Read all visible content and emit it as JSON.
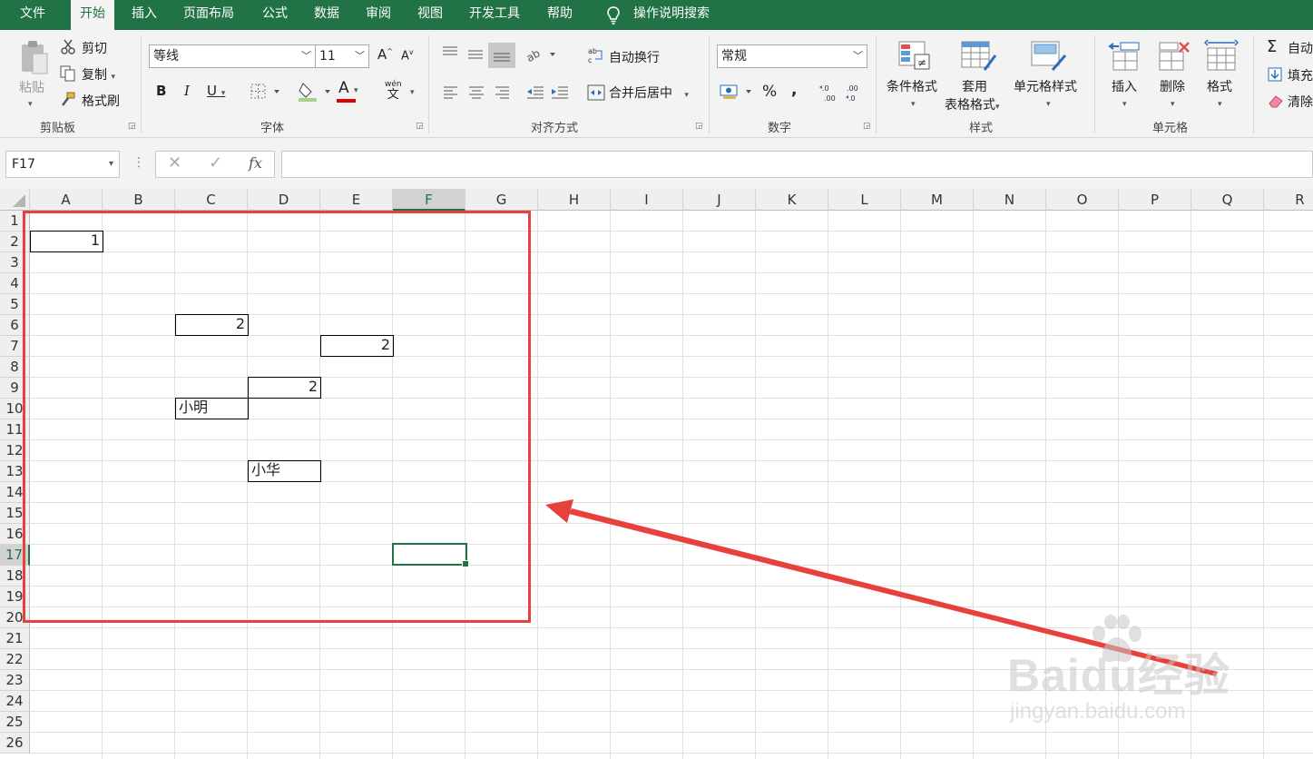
{
  "menu": {
    "items": [
      "文件",
      "开始",
      "插入",
      "页面布局",
      "公式",
      "数据",
      "审阅",
      "视图",
      "开发工具",
      "帮助"
    ],
    "active": "开始",
    "tell_me": "操作说明搜索"
  },
  "ribbon": {
    "clipboard": {
      "paste": "粘贴",
      "cut": "剪切",
      "copy": "复制",
      "format_painter": "格式刷",
      "label": "剪贴板"
    },
    "font": {
      "font_name": "等线",
      "font_size": "11",
      "bold": "B",
      "italic": "I",
      "underline": "U",
      "font_color_glyph": "A",
      "phonetic_top": "wén",
      "phonetic_bottom": "文",
      "grow": "A",
      "shrink": "A",
      "label": "字体"
    },
    "alignment": {
      "wrap_text": "自动换行",
      "merge_center": "合并后居中",
      "label": "对齐方式"
    },
    "number": {
      "format": "常规",
      "percent": "%",
      "comma": ",",
      "label": "数字"
    },
    "styles": {
      "conditional": "条件格式",
      "table_line1": "套用",
      "table_line2": "表格格式",
      "cell_styles": "单元格样式",
      "label": "样式"
    },
    "cells": {
      "insert": "插入",
      "delete": "删除",
      "format": "格式",
      "label": "单元格"
    },
    "editing": {
      "autosum": "自动",
      "fill": "填充",
      "clear": "清除"
    }
  },
  "formula_bar": {
    "name_box": "F17",
    "fx": "fx",
    "content": ""
  },
  "sheet": {
    "columns": [
      "A",
      "B",
      "C",
      "D",
      "E",
      "F",
      "G",
      "H",
      "I",
      "J",
      "K",
      "L",
      "M",
      "N",
      "O",
      "P",
      "Q",
      "R"
    ],
    "rows": [
      "1",
      "2",
      "3",
      "4",
      "5",
      "6",
      "7",
      "8",
      "9",
      "10",
      "11",
      "12",
      "13",
      "14",
      "15",
      "16",
      "17",
      "18",
      "19",
      "20",
      "21",
      "22",
      "23",
      "24",
      "25",
      "26"
    ],
    "selected_column": "F",
    "selected_row": "17",
    "cells": {
      "A2": "1",
      "C6": "2",
      "E7": "2",
      "D9": "2",
      "C10": "小明",
      "D13": "小华"
    }
  },
  "watermark": {
    "brand": "Baidu经验",
    "url": "jingyan.baidu.com"
  },
  "colors": {
    "accent": "#217346",
    "annotation": "#e8403a"
  }
}
